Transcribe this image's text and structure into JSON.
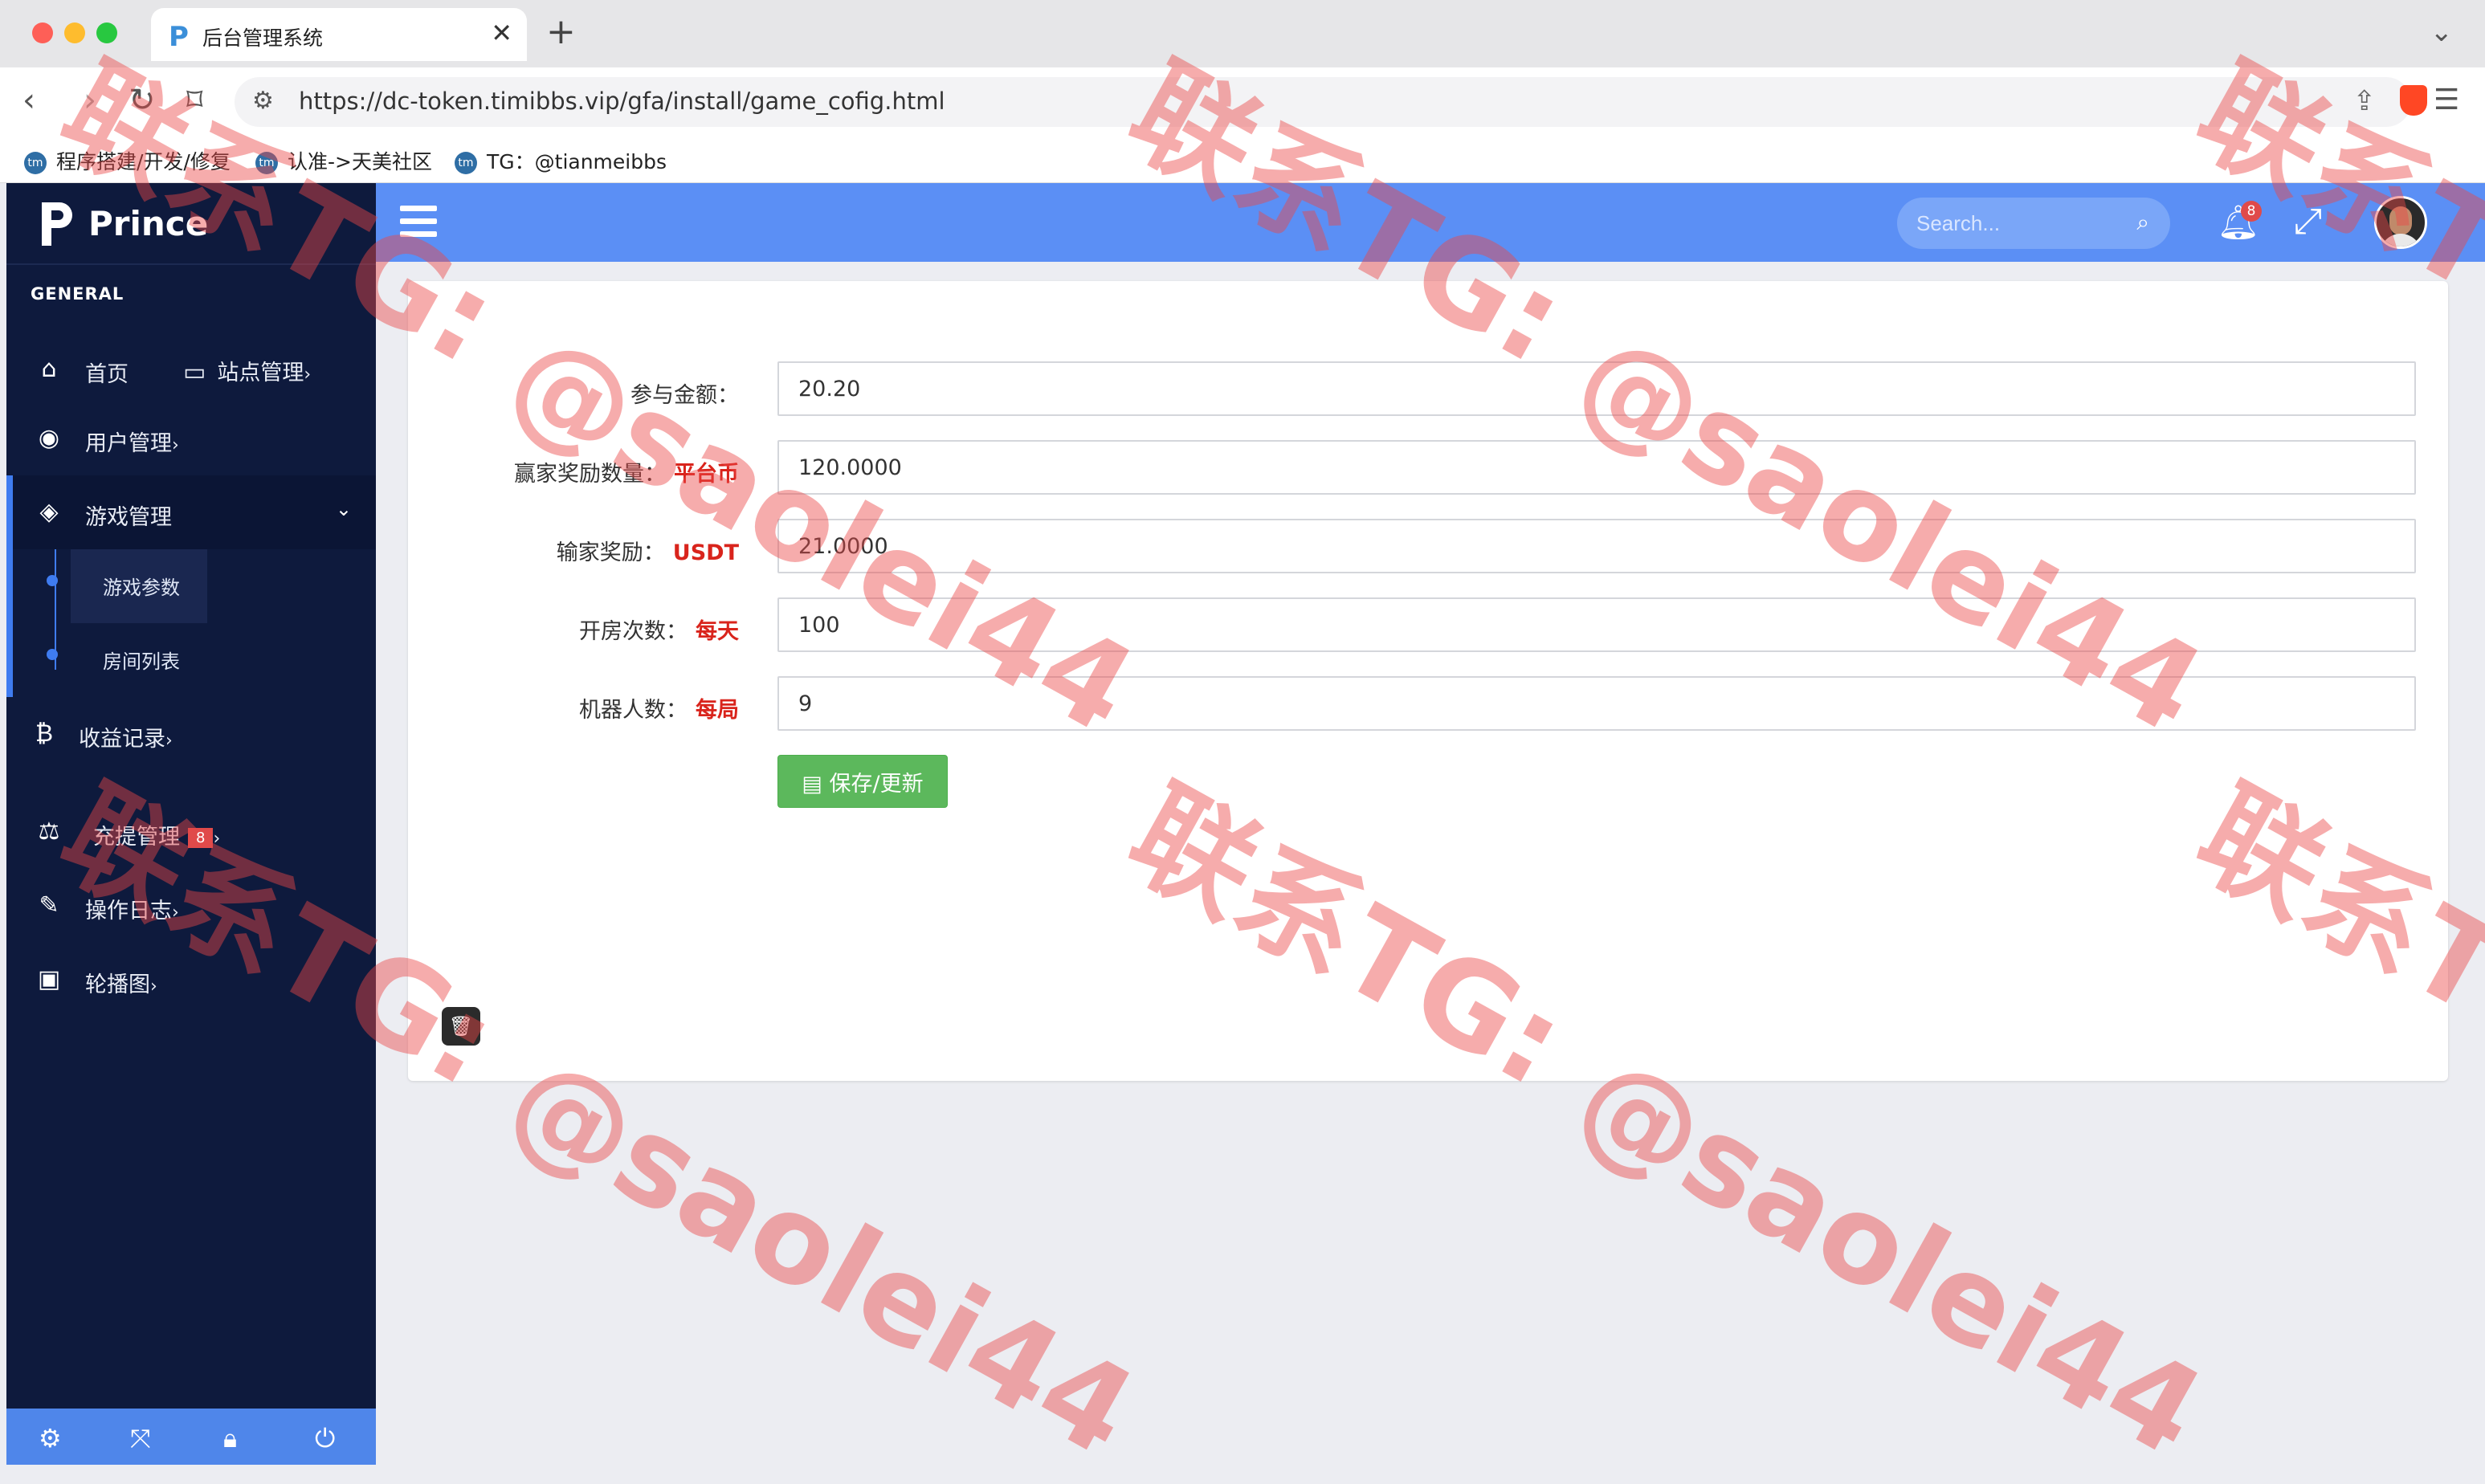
{
  "browser": {
    "tab_title": "后台管理系统",
    "tab_favicon": "P",
    "url": "https://dc-token.timibbs.vip/gfa/install/game_cofig.html",
    "bookmarks": [
      {
        "label": "程序搭建/开发/修复"
      },
      {
        "label": "认准->天美社区"
      },
      {
        "label": "TG：@tianmeibbs"
      }
    ]
  },
  "brand": {
    "name": "Prince"
  },
  "sidebar": {
    "group_label": "GENERAL",
    "items": {
      "home": "首页",
      "site": "站点管理",
      "users": "用户管理",
      "games": "游戏管理",
      "game_params": "游戏参数",
      "room_list": "房间列表",
      "income": "收益记录",
      "recharge": "充提管理",
      "recharge_badge": "8",
      "logs": "操作日志",
      "banner": "轮播图"
    },
    "caret": "›"
  },
  "topbar": {
    "search_placeholder": "Search...",
    "notif_count": "8"
  },
  "form": {
    "rows": [
      {
        "label": "参与金额：",
        "unit": "",
        "value": "20.20"
      },
      {
        "label": "赢家奖励数量：",
        "unit": "平台币",
        "value": "120.0000"
      },
      {
        "label": "输家奖励：",
        "unit": "USDT",
        "value": "21.0000"
      },
      {
        "label": "开房次数：",
        "unit": "每天",
        "value": "100"
      },
      {
        "label": "机器人数：",
        "unit": "每局",
        "value": "9"
      }
    ],
    "save_label": "保存/更新"
  },
  "watermark": {
    "line1": "联系TG:",
    "line2": "@saolei44"
  },
  "colors": {
    "sidebar_bg": "#0e1a3d",
    "topbar_bg": "#5b8ff5",
    "accent": "#3f7cf0",
    "unit_red": "#d9241c",
    "save_green": "#5cb85c",
    "badge_red": "#e04a4a"
  }
}
